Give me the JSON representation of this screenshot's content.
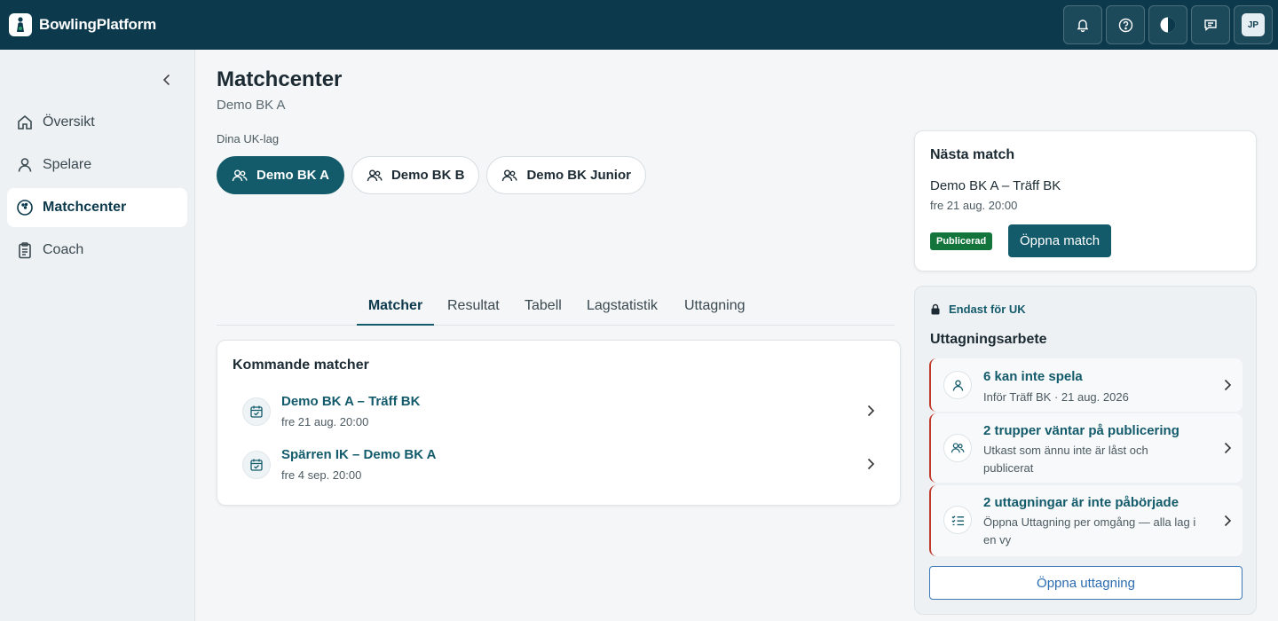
{
  "app": {
    "name": "BowlingPlatform"
  },
  "header": {
    "avatar_initials": "JP",
    "icons": [
      "bell-icon",
      "help-icon",
      "contrast-icon",
      "chat-icon"
    ]
  },
  "sidebar": {
    "items": [
      {
        "label": "Översikt",
        "icon": "home-icon"
      },
      {
        "label": "Spelare",
        "icon": "user-icon"
      },
      {
        "label": "Matchcenter",
        "icon": "bowling-ball-icon",
        "active": true
      },
      {
        "label": "Coach",
        "icon": "clipboard-icon"
      }
    ]
  },
  "page": {
    "title": "Matchcenter",
    "subtitle": "Demo BK A",
    "teams_label": "Dina UK-lag",
    "teams": [
      {
        "label": "Demo BK A",
        "active": true
      },
      {
        "label": "Demo BK B"
      },
      {
        "label": "Demo BK Junior"
      }
    ]
  },
  "tabs": [
    {
      "label": "Matcher",
      "active": true
    },
    {
      "label": "Resultat"
    },
    {
      "label": "Tabell"
    },
    {
      "label": "Lagstatistik"
    },
    {
      "label": "Uttagning"
    }
  ],
  "upcoming": {
    "title": "Kommande matcher",
    "matches": [
      {
        "name": "Demo BK A – Träff BK",
        "time": "fre 21 aug. 20:00"
      },
      {
        "name": "Spärren IK – Demo BK A",
        "time": "fre 4 sep. 20:00"
      }
    ]
  },
  "next_match": {
    "title": "Nästa match",
    "match": "Demo BK A – Träff BK",
    "time": "fre 21 aug. 20:00",
    "badge": "Publicerad",
    "open_label": "Öppna match"
  },
  "uk_panel": {
    "restricted_label": "Endast för UK",
    "title": "Uttagningsarbete",
    "tasks": [
      {
        "title": "6 kan inte spela",
        "desc": "Inför Träff BK · 21 aug. 2026",
        "icon": "user-icon"
      },
      {
        "title": "2 trupper väntar på publicering",
        "desc": "Utkast som ännu inte är låst och publicerat",
        "icon": "users-icon"
      },
      {
        "title": "2 uttagningar är inte påbörjade",
        "desc": "Öppna Uttagning per omgång — alla lag i en vy",
        "icon": "list-check-icon"
      }
    ],
    "open_label": "Öppna uttagning"
  },
  "colors": {
    "header_bg": "#0c3a4c",
    "accent": "#135b6b",
    "success": "#14753c",
    "alert_border": "#c0392b",
    "link_blue": "#2b6cb0"
  }
}
